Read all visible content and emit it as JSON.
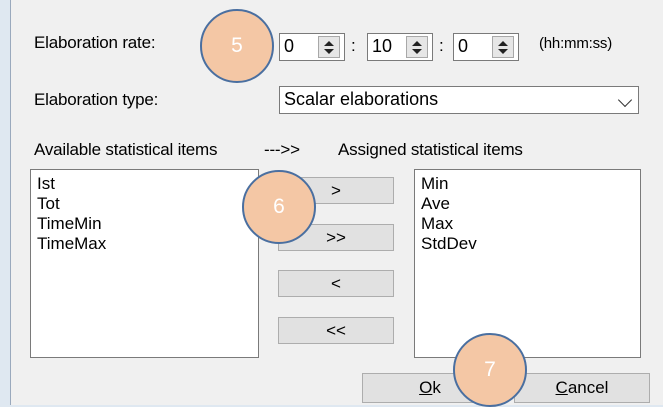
{
  "elaboration_rate": {
    "label": "Elaboration rate:",
    "hours": "0",
    "minutes": "10",
    "seconds": "0",
    "separator": ":",
    "format_hint": "(hh:mm:ss)"
  },
  "elaboration_type": {
    "label": "Elaboration type:",
    "selected": "Scalar elaborations"
  },
  "lists": {
    "available_label": "Available statistical items",
    "arrow_label": "--->>",
    "assigned_label": "Assigned statistical items",
    "available_items": [
      "Ist",
      "Tot",
      "TimeMin",
      "TimeMax"
    ],
    "assigned_items": [
      "Min",
      "Ave",
      "Max",
      "StdDev"
    ]
  },
  "transfer_buttons": {
    "add_one": ">",
    "add_all": ">>",
    "remove_one": "<",
    "remove_all": "<<"
  },
  "footer": {
    "ok_mnemonic": "O",
    "ok_rest": "k",
    "cancel_mnemonic": "C",
    "cancel_rest": "ancel"
  },
  "callouts": {
    "step_5": "5",
    "step_6": "6",
    "step_7": "7",
    "fill_color": "#f4c7a5",
    "border_color": "#4a6fa0"
  }
}
